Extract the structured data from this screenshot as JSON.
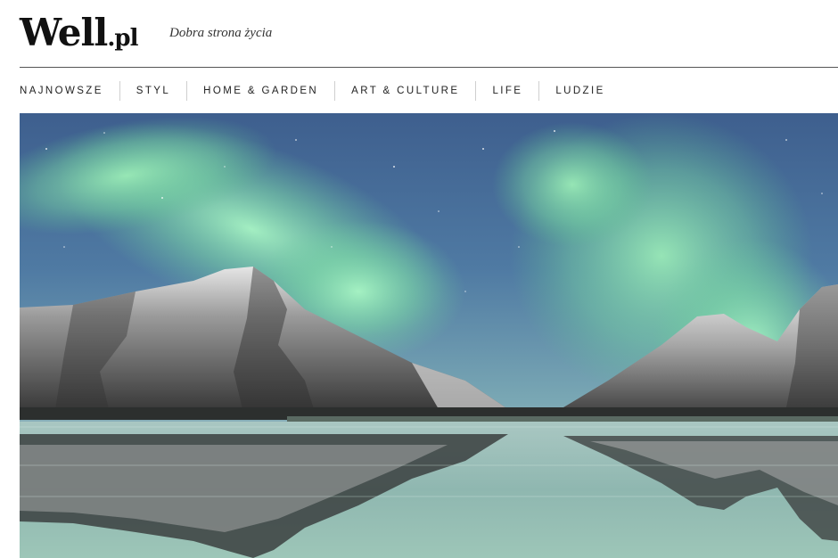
{
  "header": {
    "logo_main": "Well",
    "logo_ext": ".pl",
    "tagline": "Dobra strona życia"
  },
  "nav": {
    "items": [
      {
        "label": "NAJNOWSZE"
      },
      {
        "label": "STYL"
      },
      {
        "label": "HOME & GARDEN"
      },
      {
        "label": "ART & CULTURE"
      },
      {
        "label": "LIFE"
      },
      {
        "label": "LUDZIE"
      }
    ]
  },
  "hero": {
    "image": "aurora-over-snowy-mountains-lake-reflection"
  },
  "colors": {
    "text": "#111111",
    "divider": "#555555",
    "aurora_green": "#8ee8b0",
    "sky_blue": "#4a6c9c"
  }
}
